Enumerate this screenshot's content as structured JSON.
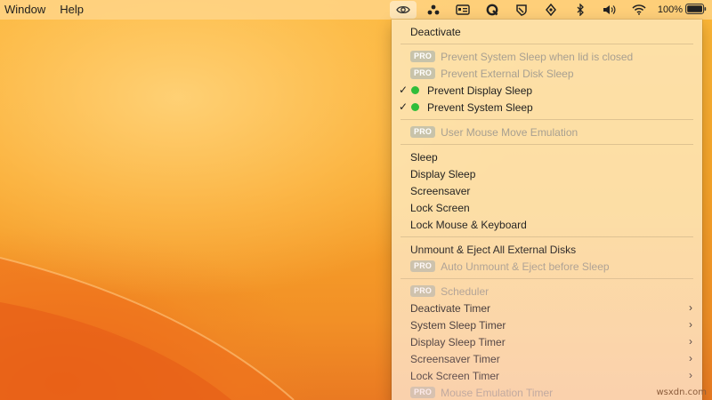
{
  "menubar": {
    "menus": [
      "Window",
      "Help"
    ],
    "status_icons": [
      "eye-icon",
      "three-dots-icon",
      "id-card-icon",
      "q-icon",
      "shield-icon",
      "rocket-icon",
      "bluetooth-icon",
      "volume-icon",
      "wifi-icon"
    ],
    "battery_text": "100%"
  },
  "menu": {
    "deactivate": "Deactivate",
    "pro_badge": "PRO",
    "prevent_lid_sleep": "Prevent System Sleep when lid is closed",
    "prevent_external_disk_sleep": "Prevent External Disk Sleep",
    "prevent_display_sleep": "Prevent Display Sleep",
    "prevent_system_sleep": "Prevent System Sleep",
    "user_mouse_move": "User Mouse Move Emulation",
    "sleep": "Sleep",
    "display_sleep": "Display Sleep",
    "screensaver": "Screensaver",
    "lock_screen": "Lock Screen",
    "lock_mouse_keyboard": "Lock Mouse & Keyboard",
    "unmount_eject": "Unmount & Eject All External Disks",
    "auto_unmount": "Auto Unmount & Eject before Sleep",
    "scheduler": "Scheduler",
    "deactivate_timer": "Deactivate Timer",
    "system_sleep_timer": "System Sleep Timer",
    "display_sleep_timer": "Display Sleep Timer",
    "screensaver_timer": "Screensaver Timer",
    "lock_screen_timer": "Lock Screen Timer",
    "mouse_emulation_timer": "Mouse Emulation Timer",
    "checkmark": "✓",
    "submenu_arrow": "›",
    "active_dot_color": "#2fbd3a"
  },
  "watermark": "wsxdn.com"
}
